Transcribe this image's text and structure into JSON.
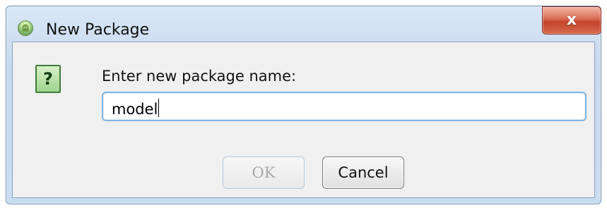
{
  "window": {
    "title": "New Package",
    "close_label": "x"
  },
  "dialog": {
    "prompt": "Enter new package name:",
    "help_glyph": "?",
    "input_value": "model",
    "ok_label": "OK",
    "cancel_label": "Cancel"
  },
  "icons": {
    "app": "android-icon",
    "help": "question-icon",
    "close": "close-icon"
  },
  "colors": {
    "titlebar": "#c7d9ee",
    "close_button": "#c14429",
    "client_bg": "#f0f0f0",
    "input_focus": "#7fb6e6",
    "help_green": "#9fd48e",
    "disabled_text": "#a7a7a7"
  }
}
